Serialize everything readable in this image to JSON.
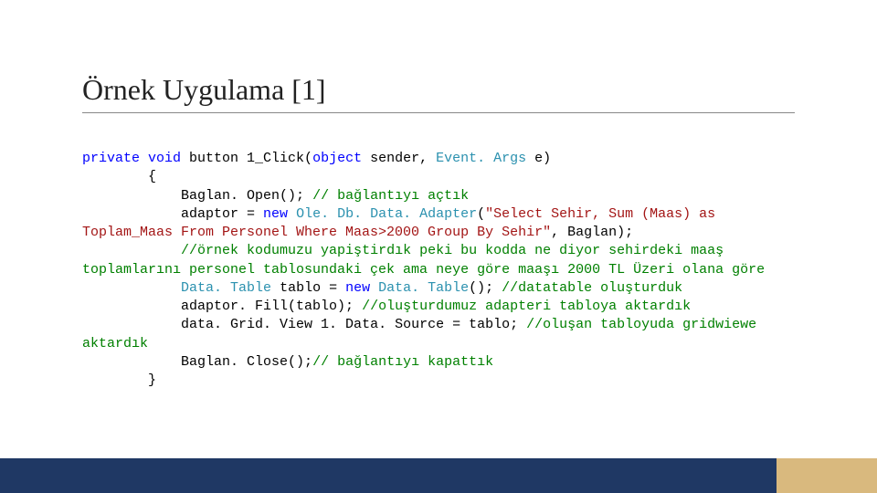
{
  "title": "Örnek Uygulama [1]",
  "code": {
    "l1a": "private",
    "l1b": " void",
    "l1c": " button 1_Click(",
    "l1d": "object",
    "l1e": " sender, ",
    "l1f": "Event. Args",
    "l1g": " e)",
    "l2": "        {",
    "l3a": "            Baglan. Open(); ",
    "l3b": "// bağlantıyı açtık",
    "l4a": "            adaptor = ",
    "l4b": "new",
    "l4c": " ",
    "l4d": "Ole. Db. Data. Adapter",
    "l4e": "(",
    "l4f": "\"Select Sehir, Sum (Maas) as Toplam_Maas From Personel Where Maas>2000 Group By Sehir\"",
    "l4g": ", Baglan);",
    "l5": "            //örnek kodumuzu yapiştirdık peki bu kodda ne diyor sehirdeki maaş toplamlarını personel tablosundaki çek ama neye göre maaşı 2000 TL Üzeri olana göre",
    "l6a": "            ",
    "l6b": "Data. Table",
    "l6c": " tablo = ",
    "l6d": "new",
    "l6e": " ",
    "l6f": "Data. Table",
    "l6g": "(); ",
    "l6h": "//datatable oluşturduk",
    "l7a": "            adaptor. Fill(tablo); ",
    "l7b": "//oluşturdumuz adapteri tabloya aktardık",
    "l8a": "            data. Grid. View 1. Data. Source = tablo; ",
    "l8b": "//oluşan tabloyuda gridwiewe aktardık",
    "l9a": "            Baglan. Close();",
    "l9b": "// bağlantıyı kapattık",
    "l10": "        }"
  }
}
